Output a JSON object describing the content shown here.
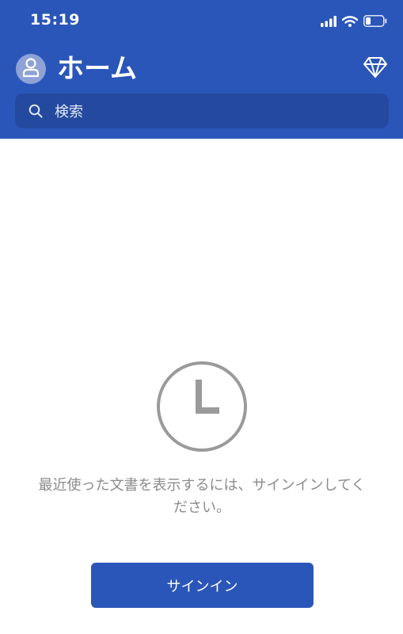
{
  "status_bar": {
    "time": "15:19",
    "signal_icon": "cellular-signal-icon",
    "wifi_icon": "wifi-icon",
    "battery_icon": "battery-low-icon"
  },
  "header": {
    "title": "ホーム",
    "avatar_icon": "person-icon",
    "premium_icon": "diamond-icon",
    "background_color": "#2b56b9"
  },
  "search": {
    "placeholder": "検索",
    "icon": "search-icon"
  },
  "empty_state": {
    "icon": "clock-icon",
    "message": "最近使った文書を表示するには、サインインしてください。"
  },
  "signin_button": {
    "label": "サインイン",
    "color": "#2b56b9"
  }
}
